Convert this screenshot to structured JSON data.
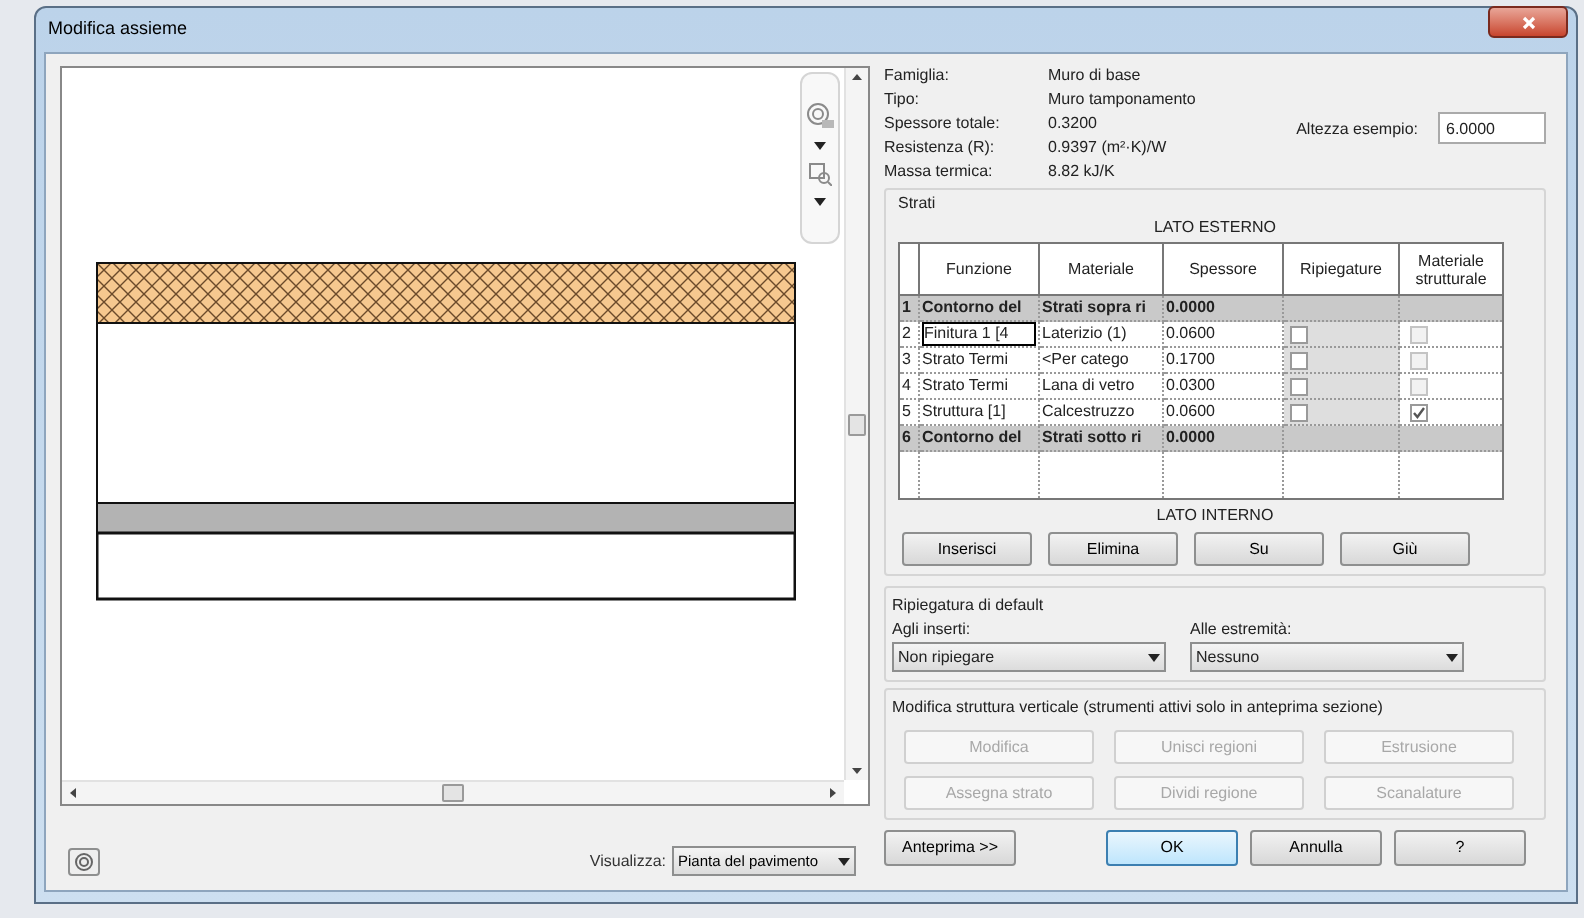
{
  "window": {
    "title": "Modifica assieme"
  },
  "properties": [
    {
      "label": "Famiglia:",
      "value": "Muro di base"
    },
    {
      "label": "Tipo:",
      "value": "Muro tamponamento"
    },
    {
      "label": "Spessore totale:",
      "value": "0.3200"
    },
    {
      "label": "Resistenza (R):",
      "value": "0.9397 (m²·K)/W"
    },
    {
      "label": "Massa termica:",
      "value": "8.82 kJ/K"
    }
  ],
  "sample_height": {
    "label": "Altezza esempio:",
    "value": "6.0000"
  },
  "layers": {
    "title": "Strati",
    "top_label": "LATO ESTERNO",
    "bottom_label": "LATO INTERNO",
    "columns": [
      "Funzione",
      "Materiale",
      "Spessore",
      "Ripiegature",
      "Materiale strutturale"
    ],
    "rows": [
      {
        "kind": "boundary",
        "number": "1",
        "function": "Contorno del",
        "material": "Strati sopra ri",
        "thickness": "0.0000",
        "selected": false
      },
      {
        "kind": "layer",
        "number": "2",
        "function": "Finitura 1 [4",
        "material": "Laterizio (1)",
        "thickness": "0.0600",
        "wraps": false,
        "structural": false,
        "selected": true
      },
      {
        "kind": "layer",
        "number": "3",
        "function": "Strato Termi",
        "material": "<Per catego",
        "thickness": "0.1700",
        "wraps": false,
        "structural": false,
        "selected": false
      },
      {
        "kind": "layer",
        "number": "4",
        "function": "Strato Termi",
        "material": "Lana di  vetro",
        "thickness": "0.0300",
        "wraps": false,
        "structural": false,
        "selected": false
      },
      {
        "kind": "layer",
        "number": "5",
        "function": "Struttura [1]",
        "material": "Calcestruzzo",
        "thickness": "0.0600",
        "wraps": false,
        "structural": true,
        "selected": false
      },
      {
        "kind": "boundary",
        "number": "6",
        "function": "Contorno del",
        "material": "Strati sotto ri",
        "thickness": "0.0000",
        "selected": false
      }
    ],
    "buttons": [
      "Inserisci",
      "Elimina",
      "Su",
      "Giù"
    ]
  },
  "default_wrapping": {
    "title": "Ripiegatura di default",
    "inserts": {
      "label": "Agli inserti:",
      "value": "Non ripiegare"
    },
    "ends": {
      "label": "Alle estremità:",
      "value": "Nessuno"
    }
  },
  "vertical_structure": {
    "title": "Modifica struttura verticale (strumenti attivi solo in anteprima sezione)",
    "buttons": [
      {
        "label": "Modifica",
        "disabled": true
      },
      {
        "label": "Unisci regioni",
        "disabled": true
      },
      {
        "label": "Estrusione",
        "disabled": true
      },
      {
        "label": "Assegna strato",
        "disabled": true
      },
      {
        "label": "Dividi regione",
        "disabled": true
      },
      {
        "label": "Scanalature",
        "disabled": true
      }
    ]
  },
  "view": {
    "label": "Visualizza:",
    "value": "Pianta del pavimento"
  },
  "footer_buttons": [
    {
      "label": "Anteprima >>",
      "primary": false
    },
    {
      "label": "OK",
      "primary": true
    },
    {
      "label": "Annulla",
      "primary": false
    },
    {
      "label": "?",
      "primary": false
    }
  ]
}
